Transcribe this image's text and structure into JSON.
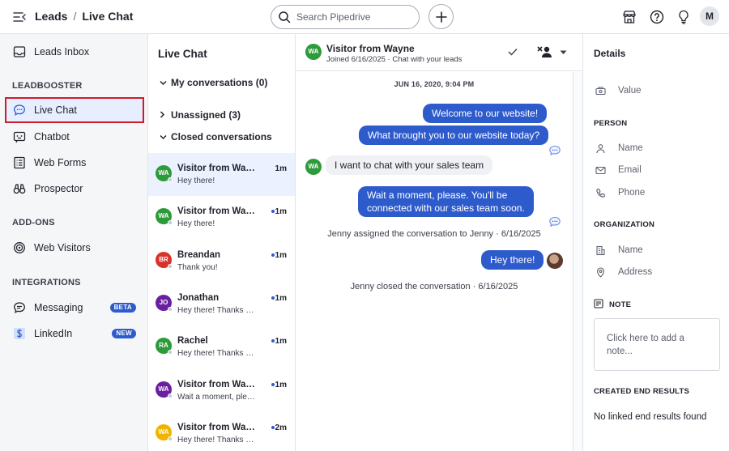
{
  "header": {
    "crumb_parent": "Leads",
    "crumb_separator": "/",
    "crumb_current": "Live Chat",
    "search_placeholder": "Search Pipedrive",
    "avatar_initial": "M"
  },
  "sidebar": {
    "leads_inbox": "Leads Inbox",
    "section_leadbooster": "LEADBOOSTER",
    "live_chat": "Live Chat",
    "chatbot": "Chatbot",
    "web_forms": "Web Forms",
    "prospector": "Prospector",
    "section_addons": "ADD-ONS",
    "web_visitors": "Web Visitors",
    "section_integrations": "INTEGRATIONS",
    "messaging": "Messaging",
    "messaging_badge": "BETA",
    "linkedin": "LinkedIn",
    "linkedin_badge": "NEW"
  },
  "conversations": {
    "title": "Live Chat",
    "group_mine": "My conversations (0)",
    "group_unassigned": "Unassigned (3)",
    "group_closed": "Closed conversations",
    "items": [
      {
        "initials": "WA",
        "name": "Visitor from Wayne",
        "preview": "Hey there!",
        "time": "1m",
        "unread": false,
        "color": "#2d9b3a",
        "selected": true
      },
      {
        "initials": "WA",
        "name": "Visitor from Wayne",
        "preview": "Hey there!",
        "time": "1m",
        "unread": true,
        "color": "#2d9b3a",
        "selected": false
      },
      {
        "initials": "BR",
        "name": "Breandan",
        "preview": "Thank you!",
        "time": "1m",
        "unread": true,
        "color": "#d8322b",
        "selected": false
      },
      {
        "initials": "JO",
        "name": "Jonathan",
        "preview": "Hey there! Thanks for reaching out",
        "time": "1m",
        "unread": true,
        "color": "#6a1fa0",
        "selected": false
      },
      {
        "initials": "RA",
        "name": "Rachel",
        "preview": "Hey there! Thanks for reaching out",
        "time": "1m",
        "unread": true,
        "color": "#2d9b3a",
        "selected": false
      },
      {
        "initials": "WA",
        "name": "Visitor from Wayne",
        "preview": "Wait a moment, please.",
        "time": "1m",
        "unread": true,
        "color": "#6a1fa0",
        "selected": false
      },
      {
        "initials": "WA",
        "name": "Visitor from Wayne",
        "preview": "Hey there! Thanks for reaching out",
        "time": "2m",
        "unread": true,
        "color": "#f0b400",
        "selected": false
      }
    ]
  },
  "chat": {
    "visitor_initials": "WA",
    "visitor_name": "Visitor from Wayne",
    "visitor_sub": "Joined 6/16/2025 · Chat with your leads",
    "date_separator": "JUN 16, 2020, 9:04 PM",
    "msg_welcome": "Welcome to our website!",
    "msg_brought": "What brought you to our website today?",
    "msg_visitor": "I want to chat with your sales team",
    "msg_wait_1": "Wait a moment, please. You'll be",
    "msg_wait_2": "connected with our sales team soon.",
    "sys_assigned": "Jenny assigned the conversation to Jenny · 6/16/2025",
    "msg_hey": "Hey there!",
    "sys_closed": "Jenny closed the conversation · 6/16/2025"
  },
  "details": {
    "title": "Details",
    "value_label": "Value",
    "section_person": "PERSON",
    "person_name": "Name",
    "person_email": "Email",
    "person_phone": "Phone",
    "section_org": "ORGANIZATION",
    "org_name": "Name",
    "org_address": "Address",
    "section_note": "NOTE",
    "note_placeholder": "Click here to add a note...",
    "section_results": "CREATED END RESULTS",
    "results_empty": "No linked end results found"
  },
  "colors": {
    "accent": "#2e5bcc",
    "active_border": "#d11a2a",
    "active_bg": "#e6eeff"
  }
}
